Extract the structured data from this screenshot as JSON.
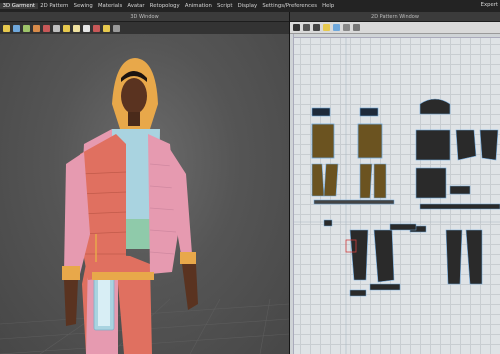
{
  "menu": {
    "items": [
      "3D Garment",
      "2D Pattern",
      "Sewing",
      "Materials",
      "Avatar",
      "Retopology",
      "Animation",
      "Script",
      "Display",
      "Settings/Preferences",
      "Help"
    ],
    "active_index": 0,
    "right_label": "Expert"
  },
  "windows": {
    "left_title": "3D Window",
    "right_title": "2D Pattern Window"
  },
  "icons": {
    "toolbar3d": [
      "select-icon",
      "move-icon",
      "fold-icon",
      "pin-icon",
      "tack-icon",
      "measure-icon",
      "camera-icon",
      "texture-icon",
      "brush-icon",
      "eraser-icon",
      "lock-icon",
      "display-icon"
    ],
    "toolbar2d": [
      "transform-pattern-icon",
      "edit-point-icon",
      "polygon-icon",
      "rectangle-icon",
      "circle-icon",
      "internal-line-icon",
      "dart-icon",
      "segment-icon",
      "sewing-icon"
    ]
  },
  "colors": {
    "menu_bg": "#232323",
    "viewport_bg": "#555555",
    "pattern_bg": "#dfe3e6",
    "vest_coral": "#e07060",
    "vest_pink": "#e69ab0",
    "hood_yellow": "#e8a84a",
    "shirt_blue": "#a9d3e0",
    "shirt_mint": "#8fcaaa",
    "plaid_brown": "#6b5320",
    "outline_blue": "#6fa8dc",
    "dark_piece": "#2a2a2a"
  }
}
